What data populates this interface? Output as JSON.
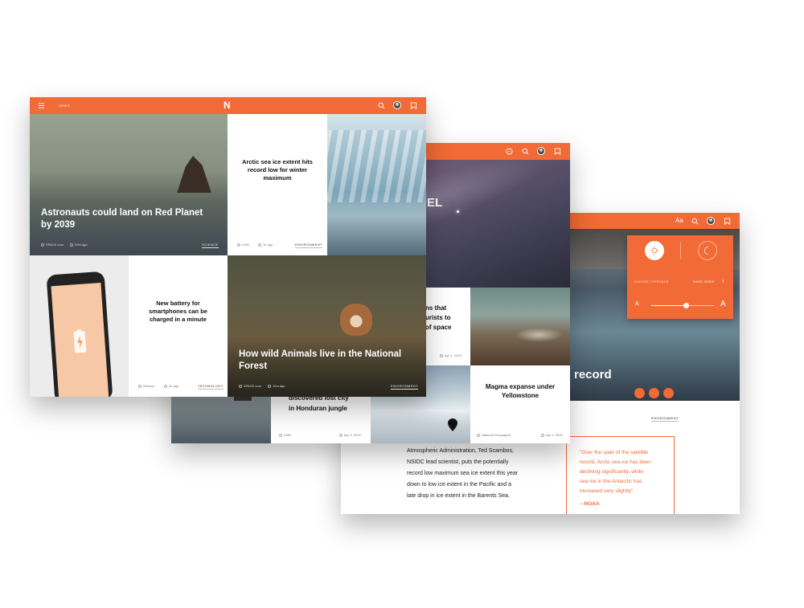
{
  "screen1": {
    "nav_label": "NEWS",
    "logo": "N",
    "tiles": {
      "astronauts": {
        "title": "Astronauts could land on Red Planet by 2039",
        "source": "SPACE.com",
        "time": "20m ago",
        "tag": "SCIENCE"
      },
      "arctic": {
        "title": "Arctic sea ice extent hits record low for winter maximum",
        "source": "CNN",
        "time": "1h ago",
        "tag": "ENVIRONMENT"
      },
      "battery": {
        "title": "New battery for smartphones can be charged in a minute",
        "source": "Reuters",
        "time": "3h ago",
        "tag": "TECHNOLOGY"
      },
      "animals": {
        "title": "How wild Animals live in the National Forest",
        "source": "SPACE.com",
        "time": "10m ago",
        "tag": "ENVIRONMENT"
      }
    }
  },
  "screen2": {
    "hero_partial": "EL",
    "partial_text": "ns that\nurists to\nof space",
    "partial_date": "Apr 1, 2015",
    "lost_city": "discovered lost city\nin Honduran jungle",
    "lost_source": "CNN",
    "lost_date": "Apr 3, 2015",
    "magma": {
      "title": "Magma expanse under Yellowstone",
      "source": "National Geographic",
      "date": "Apr 1, 2015"
    }
  },
  "screen3": {
    "aa_label": "Aa",
    "hero_partial": "record",
    "settings": {
      "typeface_label": "CHOOSE TYPEFACE",
      "typeface_value": "SANS SERIF",
      "size_small": "A",
      "size_large": "A",
      "size_level": 0.55
    },
    "tag": "ENVIRONMENT",
    "body_text": [
      "Atmospheric Administration, Ted Scambos,",
      "NSIDC lead scientist, puts the potentially",
      "record low maximum sea ice extent this year",
      "down to low ice extent in the Pacific and a",
      "late drop in ice extent in the Barents Sea."
    ],
    "quote": [
      "\"Over the span of the satellite",
      "record, Arctic sea ice has been",
      "declining significantly, while",
      "sea ice in the Antarctic has",
      "increased very slightly\""
    ],
    "quote_author": "– NOAA"
  },
  "colors": {
    "accent": "#f26a35"
  }
}
